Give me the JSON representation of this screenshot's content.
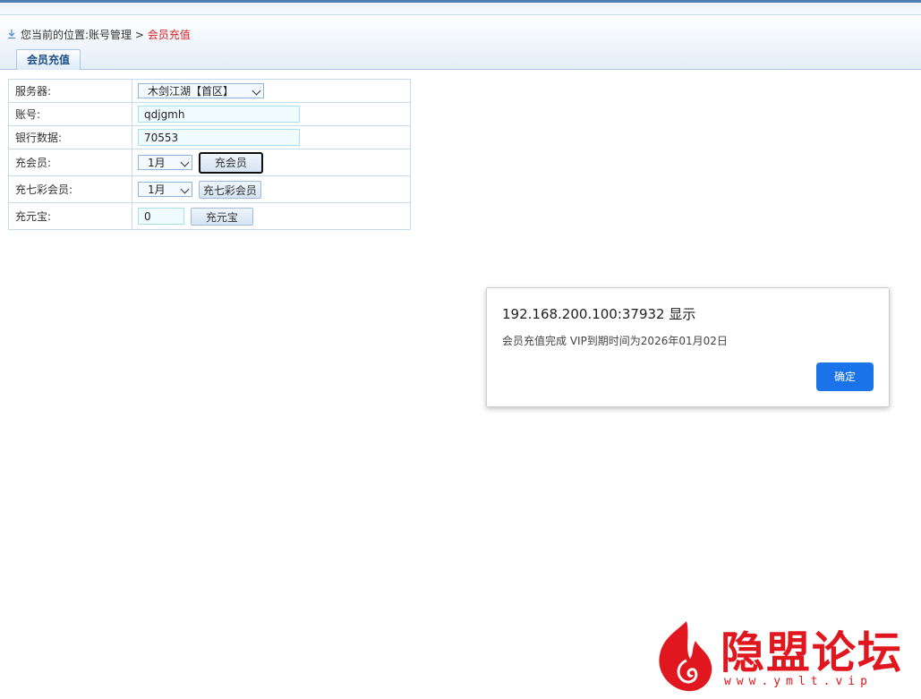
{
  "breadcrumb": {
    "prefix": "您当前的位置:",
    "section": "账号管理",
    "separator": " > ",
    "current": "会员充值"
  },
  "tab": {
    "label": "会员充值"
  },
  "form": {
    "server": {
      "label": "服务器:",
      "value": "木剑江湖【首区】"
    },
    "account": {
      "label": "账号:",
      "value": "qdjgmh"
    },
    "bank": {
      "label": "银行数据:",
      "value": "70553"
    },
    "vip": {
      "label": "充会员:",
      "select": "1月",
      "button": "充会员"
    },
    "colorful_vip": {
      "label": "充七彩会员:",
      "select": "1月",
      "button": "充七彩会员"
    },
    "yuanbao": {
      "label": "充元宝:",
      "value": "0",
      "button": "充元宝"
    }
  },
  "dialog": {
    "title": "192.168.200.100:37932 显示",
    "message": "会员充值完成 VIP到期时间为2026年01月02日",
    "ok": "确定"
  },
  "watermark": {
    "text": "隐盟论坛",
    "url": "www.ymlt.vip"
  },
  "colors": {
    "accent": "#1a73e8",
    "breadcrumb_current": "#d81f1f",
    "watermark": "#e0171e"
  }
}
